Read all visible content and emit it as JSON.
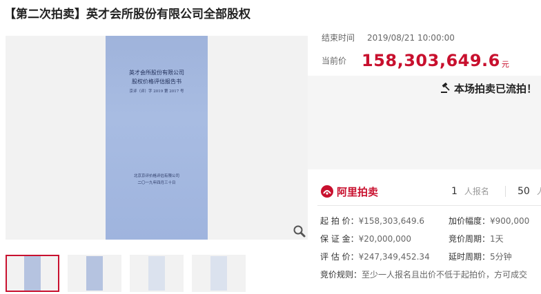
{
  "title": "【第二次拍卖】英才会所股份有限公司全部股权",
  "document": {
    "line1": "英才会所股份有限公司",
    "line2": "股权价格评估报告书",
    "line3": "京评（评）字 2019 第 2017 号",
    "line4": "北京京评价格评估有限公司",
    "line5": "二〇一九年四月三十日"
  },
  "end_time": {
    "label": "结束时间",
    "value": "2019/08/21 10:00:00"
  },
  "current_price": {
    "label": "当前价",
    "value": "158,303,649.6",
    "unit": "元"
  },
  "status_message": "本场拍卖已流拍！",
  "brand": {
    "name": "阿里拍卖"
  },
  "stats": {
    "signups": {
      "value": "1",
      "unit": "人报名"
    },
    "reminders": {
      "value": "50",
      "unit": "人"
    }
  },
  "details": {
    "start_price": {
      "label": "起 拍 价：",
      "value": "¥158,303,649.6"
    },
    "increment": {
      "label": "加价幅度：",
      "value": "¥900,000"
    },
    "deposit": {
      "label": "保 证 金：",
      "value": "¥20,000,000"
    },
    "bid_period": {
      "label": "竞价周期：",
      "value": "1天"
    },
    "appraisal": {
      "label": "评 估 价：",
      "value": "¥247,349,452.34"
    },
    "delay_period": {
      "label": "延时周期：",
      "value": "5分钟"
    },
    "rule": {
      "label": "竞价规则：",
      "value": "至少一人报名且出价不低于起拍价，方可成交"
    }
  },
  "colors": {
    "accent": "#c8102e"
  },
  "icons": [
    "zoom-icon",
    "gavel-icon",
    "ali-auction-logo-icon"
  ]
}
